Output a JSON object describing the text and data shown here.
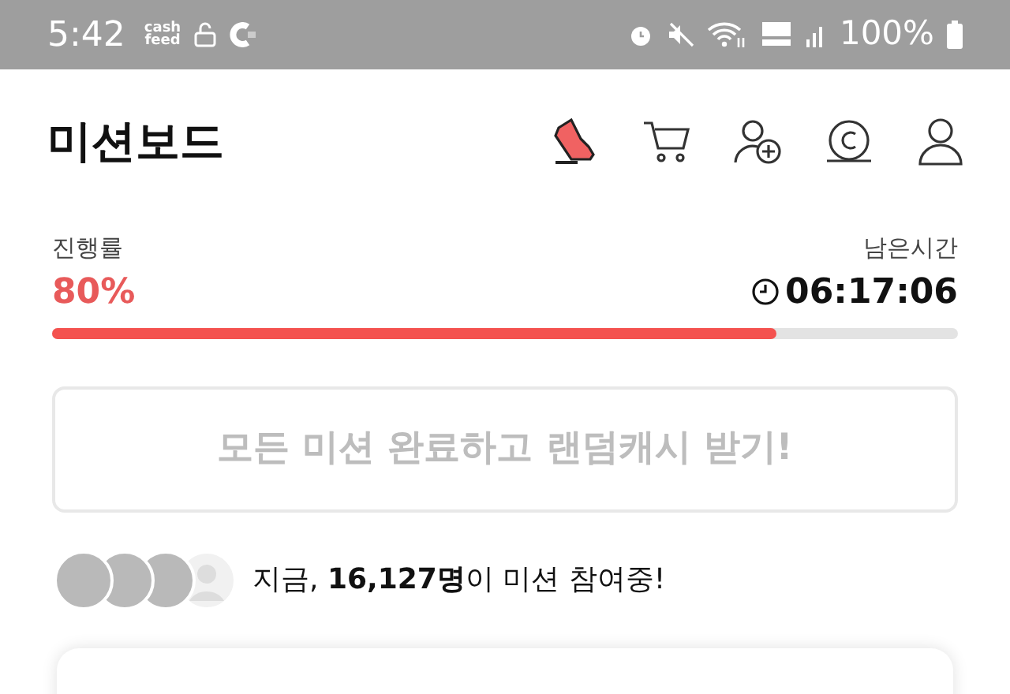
{
  "status_bar": {
    "time": "5:42",
    "app_logo": "cash\nfeed",
    "battery_text": "100%"
  },
  "header": {
    "title": "미션보드"
  },
  "progress": {
    "label": "진행률",
    "percent": "80%",
    "level": 0.8,
    "time_label": "남은시간",
    "time_left": "06:17:06"
  },
  "reward_button": {
    "label": "모든 미션 완료하고 랜덤캐시 받기!",
    "disabled": true
  },
  "participants": {
    "avatars": [
      {
        "kind": "photo"
      },
      {
        "kind": "photo"
      },
      {
        "kind": "photo"
      },
      {
        "kind": "default"
      }
    ],
    "text": "지금, **16,127명**이 미션 참여중!"
  }
}
